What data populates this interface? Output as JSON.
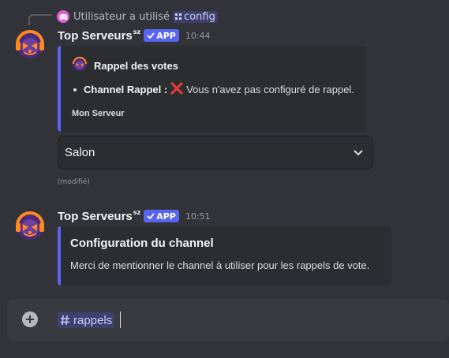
{
  "reply": {
    "user_text": "Utilisateur a utilisé",
    "command": "config"
  },
  "messages": [
    {
      "username": "Top Serveurs",
      "username_suffix": "sz",
      "app_badge": "APP",
      "time": "10:44",
      "embed": {
        "title": "Rappel des votes",
        "field_label": "Channel Rappel :",
        "field_icon": "cross-mark-icon",
        "field_value": "Vous n'avez pas configuré de rappel.",
        "footer": "Mon Serveur"
      },
      "select": {
        "placeholder": "Salon"
      },
      "edited": "(modifié)"
    },
    {
      "username": "Top Serveurs",
      "username_suffix": "sz",
      "app_badge": "APP",
      "time": "10:51",
      "embed": {
        "title": "Configuration du channel",
        "description": "Merci de mentionner le channel à utiliser pour les rappels de vote."
      }
    }
  ],
  "composer": {
    "channel_mention": "rappels"
  },
  "colors": {
    "background": "#323339",
    "embed_accent": "#5865f2",
    "error": "#e23b3b",
    "avatar_ring": "#ff8a1e",
    "avatar_face": "#6f3f9e"
  }
}
